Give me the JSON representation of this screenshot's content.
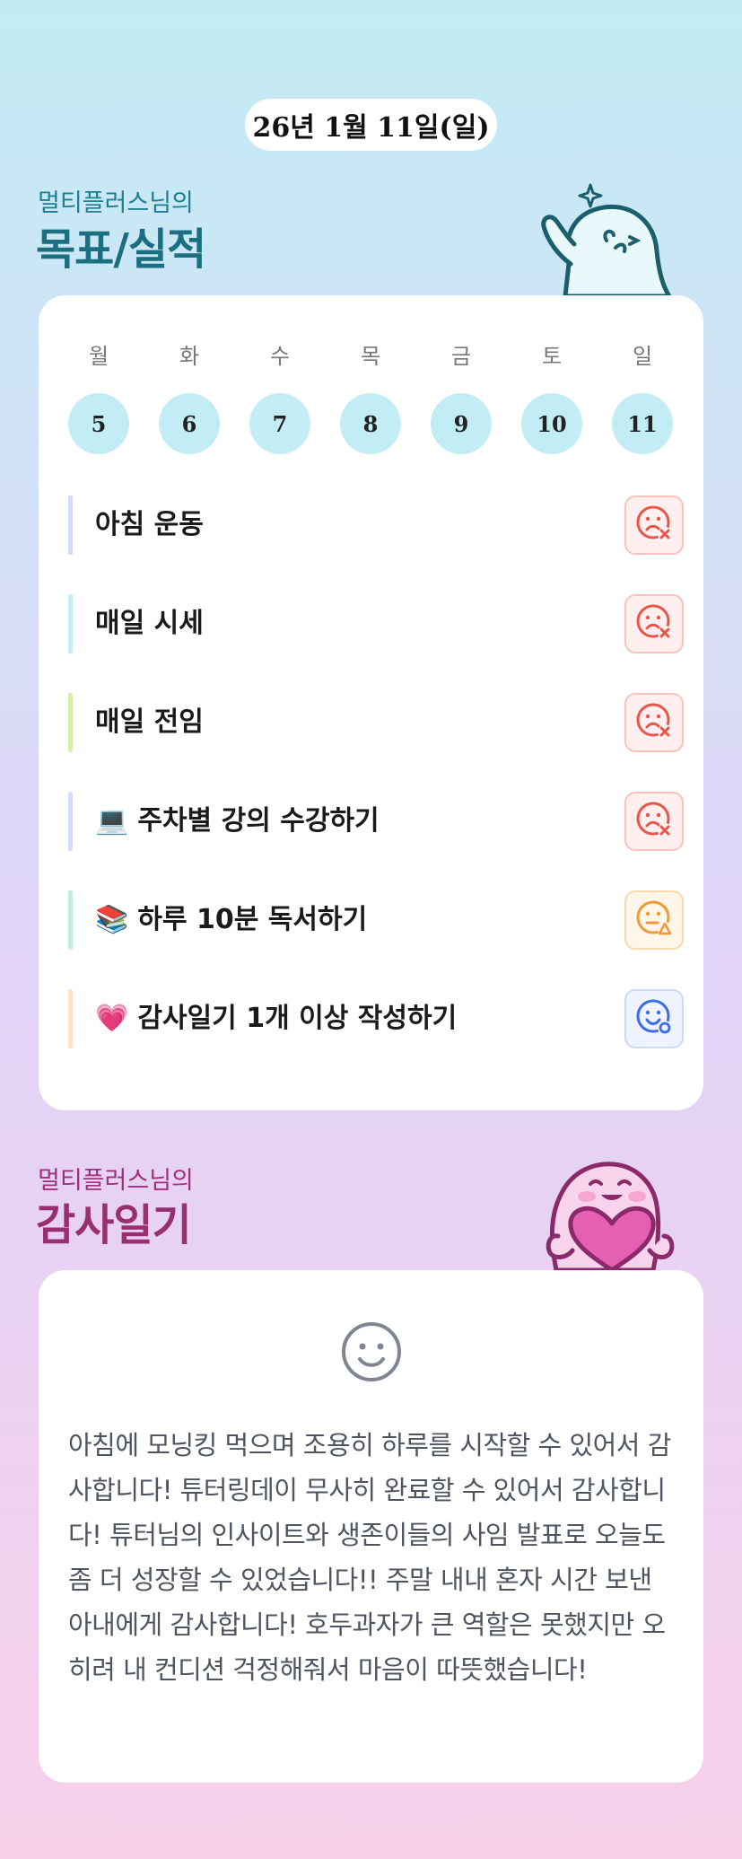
{
  "date": "26년 1월 11일(일)",
  "goals_section": {
    "subtitle": "멀티플러스님의",
    "title": "목표/실적"
  },
  "week": {
    "days": [
      "월",
      "화",
      "수",
      "목",
      "금",
      "토",
      "일"
    ],
    "dates": [
      "5",
      "6",
      "7",
      "8",
      "9",
      "10",
      "11"
    ]
  },
  "goals": [
    {
      "icon": "",
      "label": "아침 운동",
      "status": "fail",
      "status_icon": "sad-face-x-icon",
      "bar_color": "#d3dcfb"
    },
    {
      "icon": "",
      "label": "매일 시세",
      "status": "fail",
      "status_icon": "sad-face-x-icon",
      "bar_color": "#c3eef2"
    },
    {
      "icon": "",
      "label": "매일 전임",
      "status": "fail",
      "status_icon": "sad-face-x-icon",
      "bar_color": "#d5f0ad"
    },
    {
      "icon": "💻",
      "label": "주차별 강의 수강하기",
      "status": "fail",
      "status_icon": "sad-face-x-icon",
      "bar_color": "#d3dcfb"
    },
    {
      "icon": "📚",
      "label": "하루 10분 독서하기",
      "status": "partial",
      "status_icon": "neutral-face-triangle-icon",
      "bar_color": "#c3efe0"
    },
    {
      "icon": "💗",
      "label": "감사일기 1개 이상 작성하기",
      "status": "done",
      "status_icon": "smile-face-circle-icon",
      "bar_color": "#fde3c4"
    }
  ],
  "gratitude_section": {
    "subtitle": "멀티플러스님의",
    "title": "감사일기"
  },
  "gratitude": {
    "mood_icon": "smile-icon",
    "text": "아침에 모닝킹 먹으며 조용히 하루를 시작할 수 있어서 감사합니다! 튜터링데이 무사히 완료할 수 있어서 감사합니다! 튜터님의 인사이트와 생존이들의 사임 발표로 오늘도 좀 더 성장할 수 있었습니다!! 주말 내내 혼자 시간 보낸 아내에게 감사합니다! 호두과자가 큰 역할은 못했지만 오히려 내 컨디션 걱정해줘서 마음이 따뜻했습니다!"
  },
  "colors": {
    "fail": "#e8554a",
    "partial": "#f09a36",
    "done": "#3d6ce8",
    "date_circle": "#c3edf5",
    "goal_title": "#1b6f80",
    "gratitude_title": "#982f73"
  }
}
